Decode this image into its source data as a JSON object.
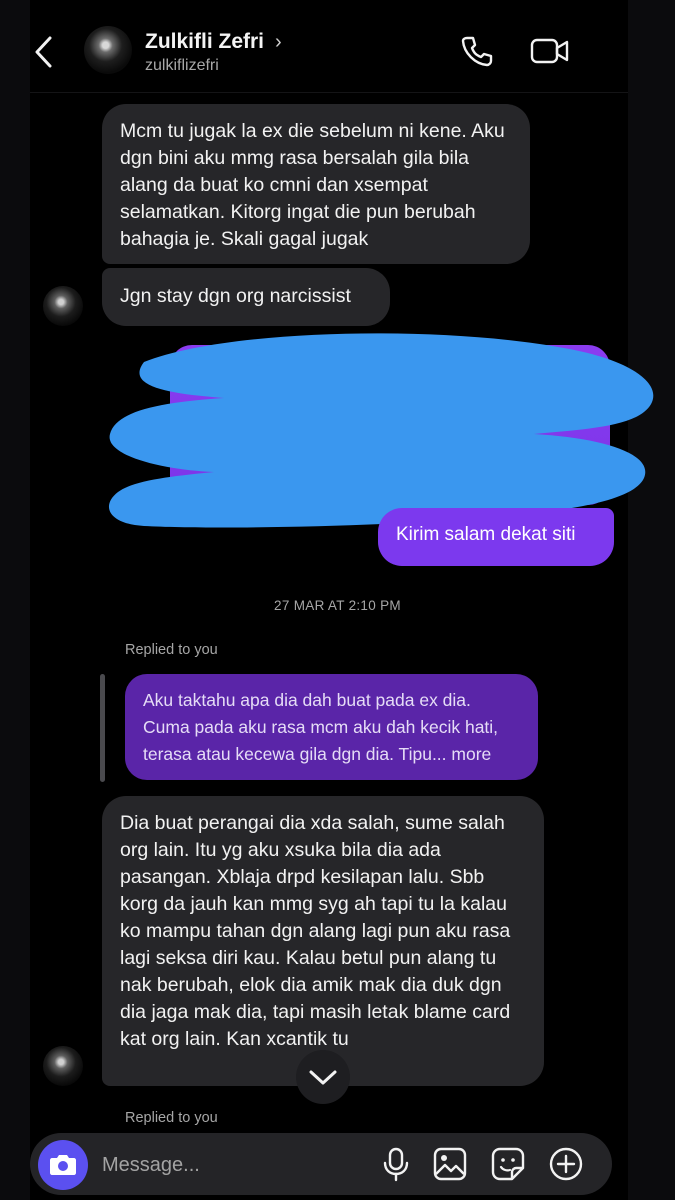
{
  "header": {
    "name": "Zulkifli Zefri",
    "username": "zulkiflizefri"
  },
  "messages": [
    {
      "text": "Mcm tu jugak la ex die sebelum ni kene. Aku dgn bini aku mmg rasa bersalah gila bila alang da buat ko cmni dan xsempat selamatkan. Kitorg ingat die pun berubah bahagia je. Skali gagal jugak"
    },
    {
      "text": "Jgn stay dgn org narcissist"
    },
    {
      "text": "Kirim salam dekat siti"
    },
    {
      "text": "Dia buat perangai dia xda salah, sume salah org lain. Itu yg aku xsuka bila dia ada pasangan. Xblaja drpd kesilapan lalu. Sbb korg da jauh kan mmg syg ah tapi tu la kalau ko mampu tahan dgn alang lagi pun aku rasa lagi seksa diri kau. Kalau betul pun alang tu nak berubah, elok dia amik mak dia duk dgn dia jaga mak dia, tapi masih letak blame card kat org lain. Kan xcantik tu"
    }
  ],
  "timestamp": "27 MAR AT 2:10 PM",
  "replied_label": "Replied to you",
  "replied_label_bottom": "Replied to you",
  "reply_quote": "Aku taktahu apa dia dah buat pada ex dia. Cuma pada aku rasa mcm aku dah kecik hati, terasa atau kecewa gila dgn dia. Tipu... more",
  "composer": {
    "placeholder": "Message..."
  },
  "colors": {
    "background": "#000000",
    "incoming_bubble": "#262629",
    "outgoing_bubble": "#7c39ee",
    "reply_quote": "#5a25a8",
    "scribble": "#3a97ef",
    "camera_button": "#5b50f0"
  },
  "icons": [
    "back-arrow-icon",
    "phone-icon",
    "video-camera-icon",
    "chevron-down-icon",
    "camera-icon",
    "microphone-icon",
    "image-icon",
    "sticker-icon",
    "plus-circle-icon"
  ]
}
